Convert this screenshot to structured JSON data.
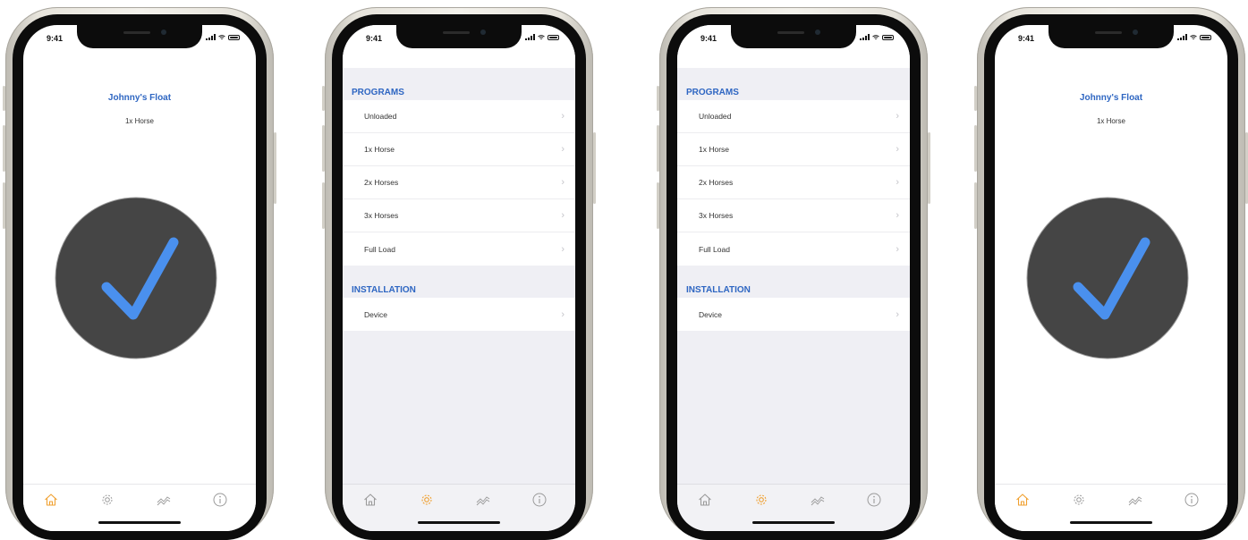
{
  "accent_color": "#f0a030",
  "title_color": "#2e66c2",
  "check_color": "#4a90ee",
  "status_bar": {
    "time": "9:41"
  },
  "home": {
    "title": "Johnny's Float",
    "subtitle": "1x Horse",
    "status_icon": "checkmark-icon"
  },
  "settings": {
    "programs_header": "PROGRAMS",
    "programs": [
      {
        "label": "Unloaded"
      },
      {
        "label": "1x Horse"
      },
      {
        "label": "2x Horses"
      },
      {
        "label": "3x Horses"
      },
      {
        "label": "Full Load"
      }
    ],
    "installation_header": "INSTALLATION",
    "installation": [
      {
        "label": "Device"
      }
    ]
  },
  "tab_bar": {
    "tabs": [
      {
        "icon": "home-icon"
      },
      {
        "icon": "gear-icon"
      },
      {
        "icon": "activity-icon"
      },
      {
        "icon": "info-icon"
      }
    ]
  }
}
